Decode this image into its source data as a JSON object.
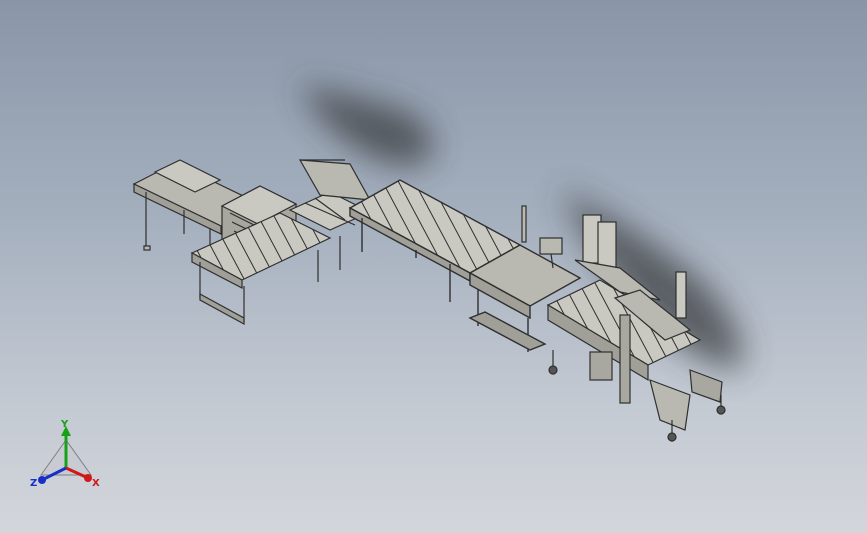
{
  "viewport": {
    "background_top": "#8a96a8",
    "background_bottom": "#d3d6db"
  },
  "model": {
    "part_color": "#b9b8b1",
    "edge_color": "#2e2f2f",
    "shadow_color": "#3a3c40"
  },
  "triad": {
    "x_label": "X",
    "y_label": "Y",
    "z_label": "Z",
    "x_color": "#d01818",
    "y_color": "#18a018",
    "z_color": "#1830c8"
  }
}
